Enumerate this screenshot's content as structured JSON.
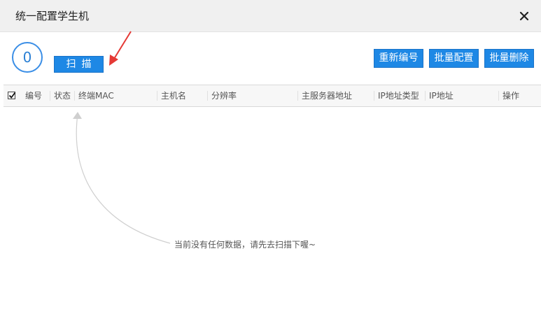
{
  "window": {
    "title": "统一配置学生机",
    "close_label": "×"
  },
  "counter": {
    "value": "0"
  },
  "toolbar": {
    "scan_label": "扫描",
    "renumber_label": "重新编号",
    "batch_config_label": "批量配置",
    "batch_delete_label": "批量删除"
  },
  "table": {
    "select_all_checked": true,
    "columns": [
      "编号",
      "状态",
      "终端MAC",
      "主机名",
      "分辨率",
      "主服务器地址",
      "IP地址类型",
      "IP地址",
      "操作"
    ],
    "rows": []
  },
  "empty_state": {
    "message": "当前没有任何数据，请先去扫描下喔~"
  },
  "colors": {
    "primary": "#1e88e5",
    "counter_ring": "#3a8ee6",
    "annotation_arrow": "#e53935",
    "hint_curve": "#cccccc"
  }
}
